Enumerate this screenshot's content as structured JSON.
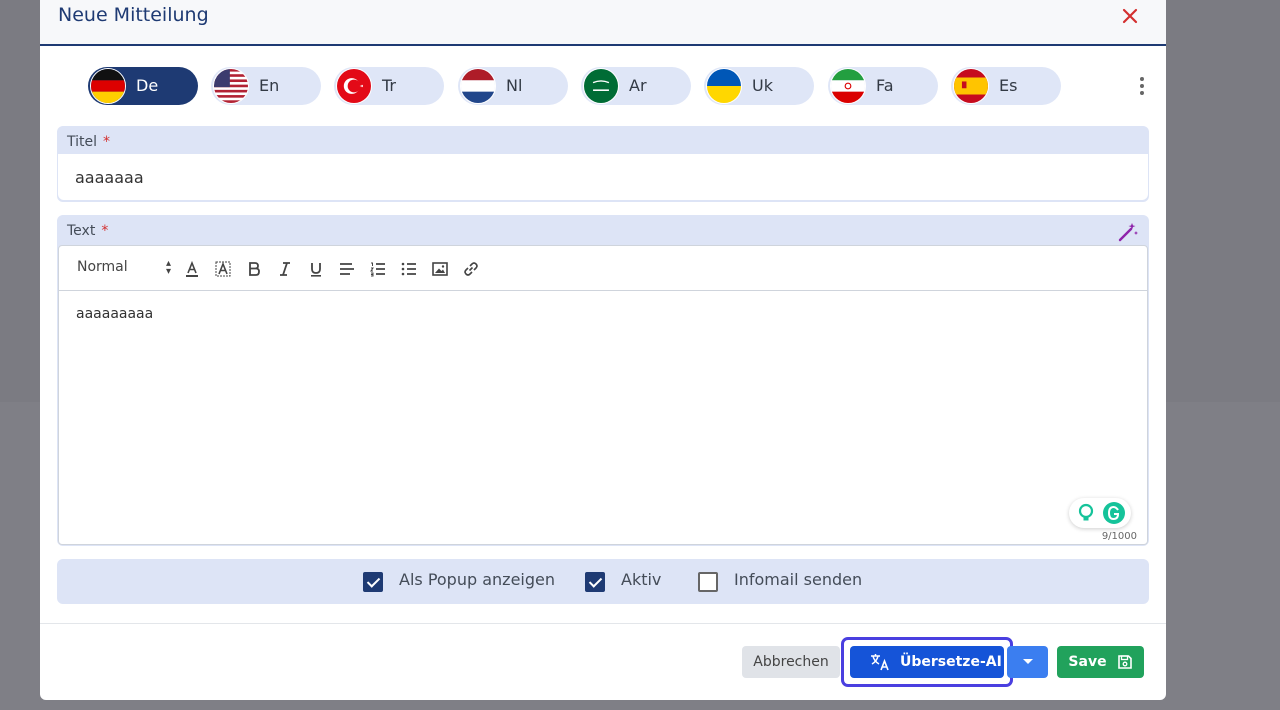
{
  "dialog": {
    "title": "Neue Mitteilung"
  },
  "languages": [
    {
      "code": "De",
      "flag": "germany-flag-icon",
      "active": true
    },
    {
      "code": "En",
      "flag": "usa-flag-icon",
      "active": false
    },
    {
      "code": "Tr",
      "flag": "turkey-flag-icon",
      "active": false
    },
    {
      "code": "Nl",
      "flag": "netherlands-flag-icon",
      "active": false
    },
    {
      "code": "Ar",
      "flag": "saudi-arabia-flag-icon",
      "active": false
    },
    {
      "code": "Uk",
      "flag": "ukraine-flag-icon",
      "active": false
    },
    {
      "code": "Fa",
      "flag": "iran-flag-icon",
      "active": false
    },
    {
      "code": "Es",
      "flag": "spain-flag-icon",
      "active": false
    }
  ],
  "form": {
    "title_label": "Titel",
    "title_value": "aaaaaaa",
    "text_label": "Text",
    "required_marker": "*",
    "editor": {
      "format_select": "Normal",
      "content": "aaaaaaaaa",
      "char_count": "9/1000"
    }
  },
  "options": {
    "popup": {
      "label": "Als Popup anzeigen",
      "checked": true
    },
    "active": {
      "label": "Aktiv",
      "checked": true
    },
    "infomail": {
      "label": "Infomail senden",
      "checked": false
    }
  },
  "footer": {
    "cancel_label": "Abbrechen",
    "translate_label": "Übersetze-AI",
    "save_label": "Save"
  },
  "colors": {
    "primary": "#1e3a73",
    "accent": "#1554d8",
    "save": "#21a25c",
    "danger": "#d32f2f",
    "panel": "#dde4f6"
  }
}
